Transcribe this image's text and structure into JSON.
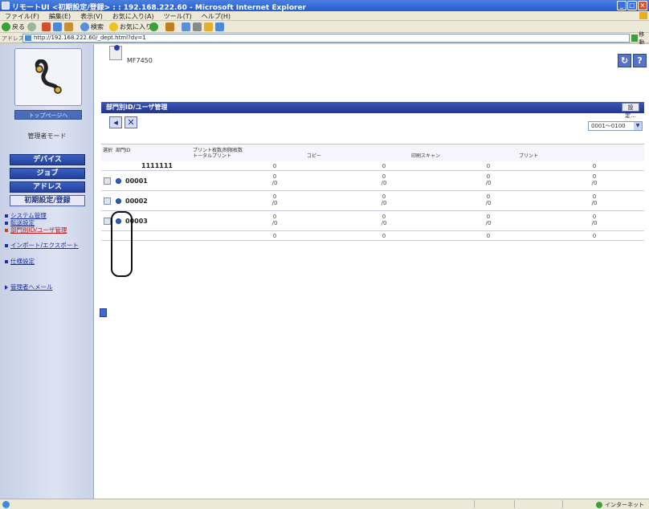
{
  "window": {
    "title": "リモートUI <初期設定/登録> : : 192.168.222.60 - Microsoft Internet Explorer"
  },
  "menubar": [
    "ファイル(F)",
    "編集(E)",
    "表示(V)",
    "お気に入り(A)",
    "ツール(T)",
    "ヘルプ(H)"
  ],
  "toolbar": {
    "back": "戻る",
    "search": "検索",
    "favorites": "お気に入り"
  },
  "address": {
    "label": "アドレス(D)",
    "url": "http://192.168.222.60/_dept.html?dv=1",
    "go": "移動"
  },
  "sidebar": {
    "toppage": "トップページへ",
    "mode": "管理者モード",
    "nav": [
      "デバイス",
      "ジョブ",
      "アドレス",
      "初期設定/登録"
    ],
    "sublinks": [
      {
        "label": "システム管理"
      },
      {
        "label": "転送設定"
      },
      {
        "label": "部門別ID/ユーザ管理"
      },
      {
        "label": "インポート/エクスポート"
      },
      {
        "label": "仕様設定"
      }
    ],
    "mail": "管理者へメール"
  },
  "device": {
    "name": "MF7450"
  },
  "panel": {
    "title": "部門別ID/ユーザ管理",
    "settings_button": "設定...",
    "range_select": "0001～0100"
  },
  "table": {
    "head": {
      "select": "選択",
      "dept_id": "部門ID",
      "print_group": "プリント枚数/制限枚数",
      "total_print": "トータルプリント",
      "copy": "コピー",
      "scan": "印刷スキャン",
      "print": "プリント"
    },
    "rows": [
      {
        "id": "1111111",
        "total": "0",
        "copy": "0",
        "scan": "0",
        "print": "0",
        "selectable": false
      },
      {
        "id": "00001",
        "total": "0",
        "total_limit": "/0",
        "copy": "0",
        "copy_limit": "/0",
        "scan": "0",
        "scan_limit": "/0",
        "print": "0",
        "print_limit": "/0",
        "selectable": true
      },
      {
        "id": "00002",
        "total": "0",
        "total_limit": "/0",
        "copy": "0",
        "copy_limit": "/0",
        "scan": "0",
        "scan_limit": "/0",
        "print": "0",
        "print_limit": "/0",
        "selectable": true
      },
      {
        "id": "00003",
        "total": "0",
        "total_limit": "/0",
        "copy": "0",
        "copy_limit": "/0",
        "scan": "0",
        "scan_limit": "/0",
        "print": "0",
        "print_limit": "/0",
        "selectable": true
      },
      {
        "id": "",
        "total": "0",
        "copy": "0",
        "scan": "0",
        "print": "0",
        "selectable": false
      }
    ]
  },
  "statusbar": {
    "zone": "インターネット"
  }
}
